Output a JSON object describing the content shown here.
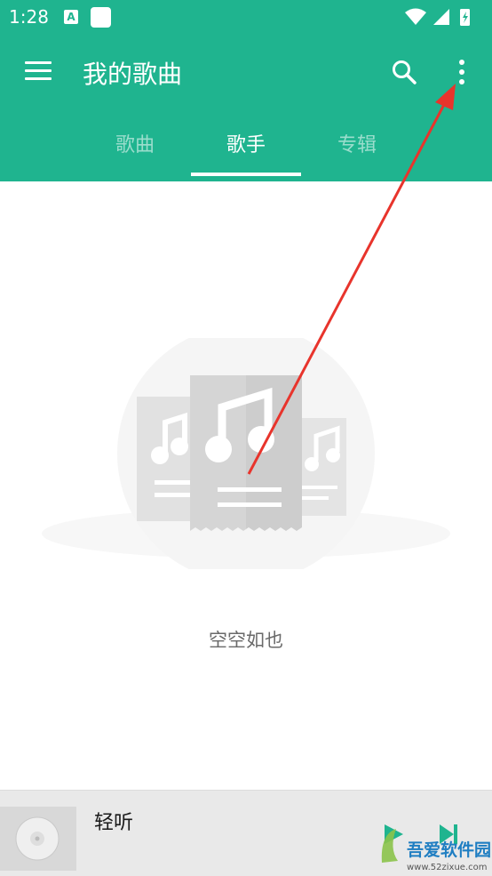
{
  "status_bar": {
    "time": "1:28",
    "app_badge": "A"
  },
  "header": {
    "title": "我的歌曲"
  },
  "tabs": [
    {
      "label": "歌曲"
    },
    {
      "label": "歌手"
    },
    {
      "label": "专辑"
    }
  ],
  "empty_state": {
    "message": "空空如也"
  },
  "player": {
    "song_title": "轻听"
  },
  "watermark": {
    "text": "吾爱软件园",
    "url": "www.52zixue.com"
  },
  "colors": {
    "primary": "#1fb48f",
    "annotation_arrow": "#e8342c",
    "player_bg": "#e9e9e9"
  }
}
